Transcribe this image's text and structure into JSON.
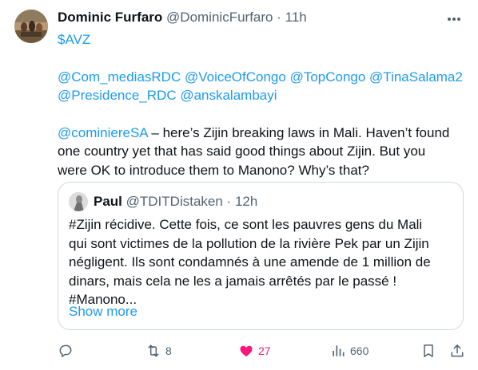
{
  "tweet": {
    "author_name": "Dominic Furfaro",
    "author_handle": "@DominicFurfaro",
    "separator": "·",
    "time": "11h",
    "cashtag": "$AVZ",
    "mentions_line1": "@Com_mediasRDC @VoiceOfCongo @TopCongo @TinaSalama2",
    "mentions_line2": "@Presidence_RDC @anskalambayi",
    "reply_mention": "@cominiereSA",
    "reply_line1_rest": " – here’s Zijin breaking laws in Mali. Haven’t found",
    "reply_line2": "one country yet that has said good things about Zijin. But you",
    "reply_line3": "were OK to introduce them to Manono? Why’s that?"
  },
  "quote": {
    "author_name": "Paul",
    "author_handle": "@TDITDistaken",
    "separator": "·",
    "time": "12h",
    "line1": "#Zijin récidive.  Cette fois, ce sont les pauvres gens du Mali",
    "line2": "qui sont victimes de la pollution de la rivière Pek par un Zijin",
    "line3": "négligent.  Ils sont condamnés à une amende de 1 million de",
    "line4": "dinars, mais cela ne les a jamais arrêtés par le passé !",
    "line5": "#Manono...",
    "show_more": "Show more"
  },
  "actions": {
    "reply_icon": "reply-icon",
    "retweet_icon": "retweet-icon",
    "retweet_count": "8",
    "like_icon": "heart-icon",
    "like_count": "27",
    "views_icon": "views-icon",
    "views_count": "660",
    "bookmark_icon": "bookmark-icon",
    "share_icon": "share-icon"
  },
  "colors": {
    "link": "#1d9bf0",
    "text": "#0f1419",
    "muted": "#536471",
    "like": "#f91880",
    "border": "#cfd9de"
  }
}
